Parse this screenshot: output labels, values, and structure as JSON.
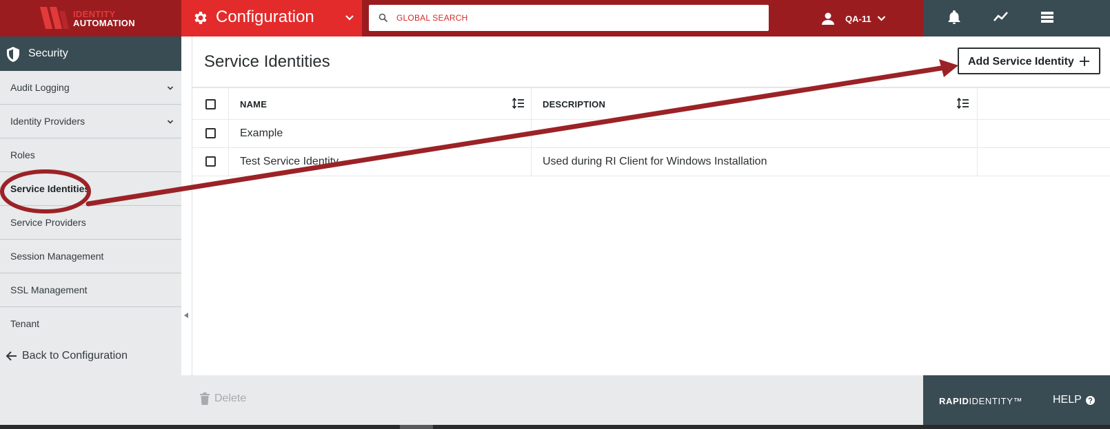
{
  "brand": {
    "logo_line1": "IDENTITY",
    "logo_line2": "AUTOMATION",
    "footer_brand_bold": "RAPID",
    "footer_brand_rest": "IDENTITY™"
  },
  "header": {
    "section_title": "Configuration",
    "search_placeholder": "GLOBAL SEARCH",
    "user_name": "QA-11"
  },
  "sidebar": {
    "title": "Security",
    "items": [
      {
        "label": "Audit Logging",
        "expandable": true
      },
      {
        "label": "Identity Providers",
        "expandable": true
      },
      {
        "label": "Roles",
        "expandable": false
      },
      {
        "label": "Service Identities",
        "expandable": false,
        "active": true
      },
      {
        "label": "Service Providers",
        "expandable": false
      },
      {
        "label": "Session Management",
        "expandable": false
      },
      {
        "label": "SSL Management",
        "expandable": false
      },
      {
        "label": "Tenant",
        "expandable": false
      }
    ],
    "back_label": "Back to Configuration"
  },
  "main": {
    "page_title": "Service Identities",
    "add_button_label": "Add Service Identity",
    "table": {
      "columns": [
        "NAME",
        "DESCRIPTION"
      ],
      "rows": [
        {
          "name": "Example",
          "description": ""
        },
        {
          "name": "Test Service Identity",
          "description": "Used during RI Client for Windows Installation"
        }
      ]
    }
  },
  "footer": {
    "delete_label": "Delete",
    "help_label": "HELP"
  },
  "colors": {
    "header_dark_red": "#9b1c1f",
    "header_red": "#e32b2b",
    "slate": "#394b53",
    "annotation": "#9b2226"
  },
  "icons": {
    "header": [
      "gear-icon",
      "chevron-down-icon",
      "search-icon",
      "user-icon",
      "bell-icon",
      "activity-chart-icon",
      "list-view-icon"
    ],
    "sidebar": [
      "shield-icon",
      "chevron-down-icon",
      "arrow-left-icon"
    ],
    "table": [
      "sort-icon"
    ],
    "footer": [
      "trash-icon",
      "help-circle-icon"
    ]
  }
}
